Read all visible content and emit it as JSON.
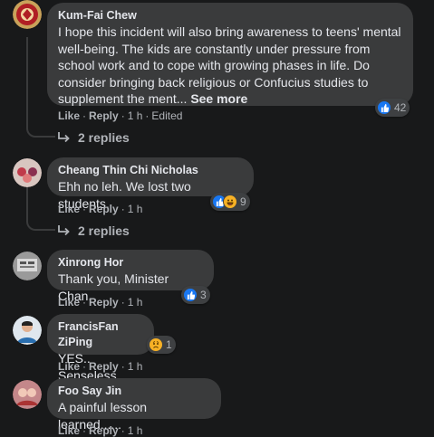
{
  "action_labels": {
    "like": "Like",
    "reply": "Reply",
    "separator": "·"
  },
  "comments": [
    {
      "author": "Kum-Fai Chew",
      "text": "I hope this incident will also bring awareness to teens' mental well-being. The kids are constantly under pressure from school work and to cope with growing phases in life. Do consider bringing back religious or Confucius studies to supplement the ment...",
      "see_more": "See more",
      "time": "1 h",
      "edited": "Edited",
      "reactions": [
        "like"
      ],
      "reaction_count": "42",
      "replies_label": "2 replies"
    },
    {
      "author": "Cheang Thin Chi Nicholas",
      "text": "Ehh no leh. We lost two students.",
      "time": "1 h",
      "reactions": [
        "like",
        "haha"
      ],
      "reaction_count": "9",
      "replies_label": "2 replies"
    },
    {
      "author": "Xinrong Hor",
      "text": "Thank you, Minister Chan.",
      "time": "1 h",
      "reactions": [
        "like"
      ],
      "reaction_count": "3"
    },
    {
      "author": "FrancisFan ZiPing",
      "text": "YES.. Senseless",
      "time": "1 h",
      "reactions": [
        "sad"
      ],
      "reaction_count": "1"
    },
    {
      "author": "Foo Say Jin",
      "text": "A painful lesson learned......",
      "time": "1 h"
    }
  ],
  "colors": {
    "background": "#18191a",
    "bubble": "#3a3b3c",
    "text_primary": "#e4e6eb",
    "text_secondary": "#b0b3b8",
    "like_blue": "#1877f2",
    "emoji_yellow": "#f7b125"
  }
}
